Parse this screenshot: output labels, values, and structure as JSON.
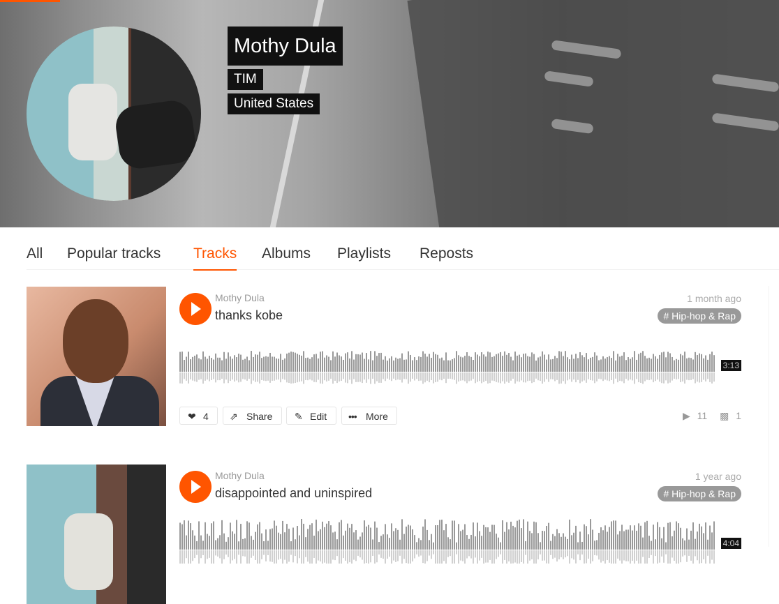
{
  "profile": {
    "name": "Mothy Dula",
    "subtitle": "TIM",
    "location": "United States"
  },
  "tabs": [
    {
      "label": "All",
      "active": false
    },
    {
      "label": "Popular tracks",
      "active": false
    },
    {
      "label": "Tracks",
      "active": true
    },
    {
      "label": "Albums",
      "active": false
    },
    {
      "label": "Playlists",
      "active": false
    },
    {
      "label": "Reposts",
      "active": false
    }
  ],
  "colors": {
    "accent": "#ff5500",
    "tag_bg": "#999999",
    "wave_bar": "#999999"
  },
  "icons": {
    "play": "play-icon",
    "like": "heart-icon",
    "share": "share-icon",
    "edit": "pencil-icon",
    "more": "more-dots-icon",
    "plays": "play-count-icon",
    "comments": "comment-icon"
  },
  "tracks": [
    {
      "artist": "Mothy Dula",
      "title": "thanks kobe",
      "posted": "1 month ago",
      "tag": "# Hip-hop & Rap",
      "duration": "3:13",
      "likes": "4",
      "share_label": "Share",
      "edit_label": "Edit",
      "more_label": "More",
      "plays": "11",
      "comments": "1"
    },
    {
      "artist": "Mothy Dula",
      "title": "disappointed and uninspired",
      "posted": "1 year ago",
      "tag": "# Hip-hop & Rap",
      "duration": "4:04"
    }
  ]
}
